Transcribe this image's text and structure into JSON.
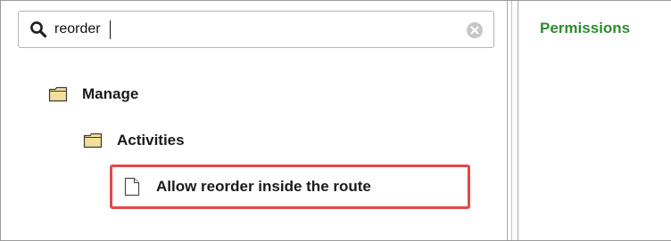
{
  "search": {
    "value": "reorder",
    "icon": "search-icon",
    "clear_icon": "clear-icon"
  },
  "tree": {
    "nodes": [
      {
        "label": "Manage",
        "icon": "folder-icon"
      },
      {
        "label": "Activities",
        "icon": "folder-icon"
      },
      {
        "label": "Allow reorder inside the route",
        "icon": "document-icon",
        "highlighted": true
      }
    ]
  },
  "right_panel": {
    "header": "Permissions"
  },
  "colors": {
    "header_green": "#2f8a2f",
    "highlight_red": "#e04a47",
    "folder_fill": "#f1e09a",
    "border_gray": "#9a9a9a"
  }
}
